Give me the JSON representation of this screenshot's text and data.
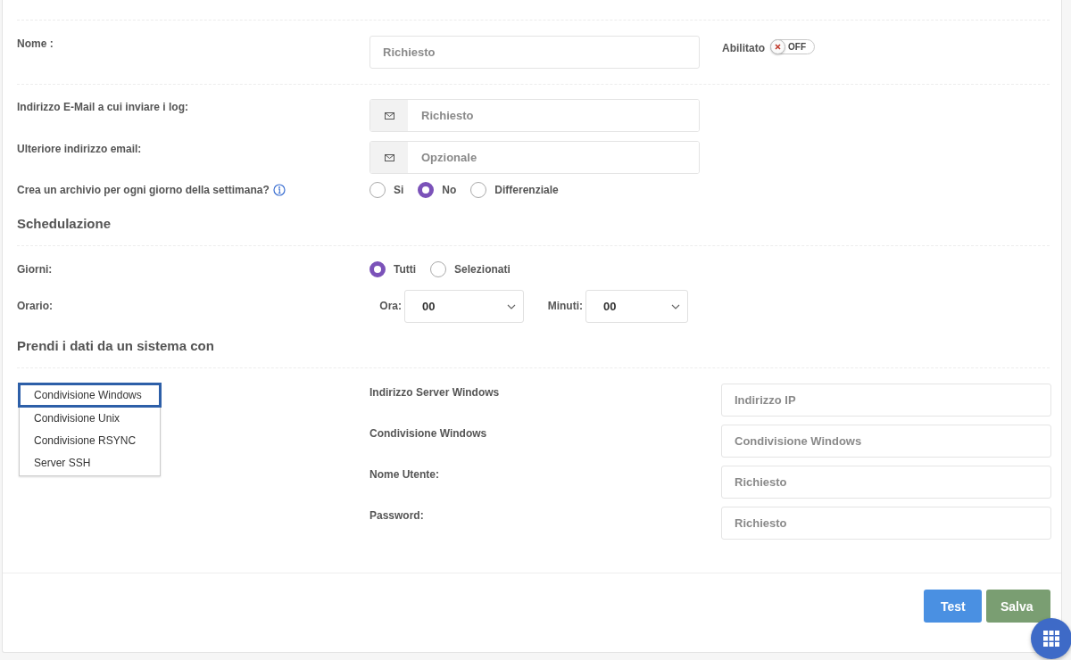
{
  "name_field": {
    "label": "Nome :",
    "placeholder": "Richiesto"
  },
  "enabled": {
    "label": "Abilitato",
    "on": false,
    "state_text": "OFF"
  },
  "email_fields": [
    {
      "label": "Indirizzo E-Mail a cui inviare i log:",
      "placeholder": "Richiesto"
    },
    {
      "label": "Ulteriore indirizzo email:",
      "placeholder": "Opzionale"
    }
  ],
  "archive": {
    "label": "Crea un archivio per ogni giorno della settimana?",
    "options": [
      {
        "label": "Si",
        "selected": false
      },
      {
        "label": "No",
        "selected": true
      },
      {
        "label": "Differenziale",
        "selected": false
      }
    ]
  },
  "schedule": {
    "title": "Schedulazione",
    "days": {
      "label": "Giorni:",
      "options": [
        {
          "label": "Tutti",
          "selected": true
        },
        {
          "label": "Selezionati",
          "selected": false
        }
      ]
    },
    "time": {
      "label": "Orario:",
      "hour": {
        "label": "Ora:",
        "value": "00"
      },
      "minutes": {
        "label": "Minuti:",
        "value": "00"
      }
    }
  },
  "source": {
    "title": "Prendi i dati da un sistema con",
    "systems": [
      {
        "label": "Condivisione Windows",
        "selected": true
      },
      {
        "label": "Condivisione Unix",
        "selected": false
      },
      {
        "label": "Condivisione RSYNC",
        "selected": false
      },
      {
        "label": "Server SSH",
        "selected": false
      }
    ],
    "fields": [
      {
        "label": "Indirizzo Server Windows",
        "placeholder": "Indirizzo IP"
      },
      {
        "label": "Condivisione Windows",
        "placeholder": "Condivisione Windows"
      },
      {
        "label": "Nome Utente:",
        "placeholder": "Richiesto"
      },
      {
        "label": "Password:",
        "placeholder": "Richiesto"
      }
    ]
  },
  "buttons": [
    {
      "label": "Test",
      "kind": "primary"
    },
    {
      "label": "Salva",
      "kind": "success"
    }
  ]
}
